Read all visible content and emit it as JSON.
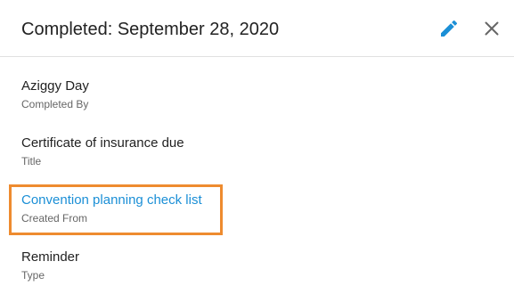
{
  "header": {
    "title": "Completed: September 28, 2020",
    "edit_icon": "pencil-icon",
    "close_icon": "close-icon",
    "accent_color": "#1b8fd6"
  },
  "fields": [
    {
      "value": "Aziggy Day",
      "label": "Completed By"
    },
    {
      "value": "Certificate of insurance due",
      "label": "Title"
    },
    {
      "value": "Convention planning check list",
      "label": "Created From"
    },
    {
      "value": "Reminder",
      "label": "Type"
    }
  ],
  "highlight_color": "#ee8b2f"
}
